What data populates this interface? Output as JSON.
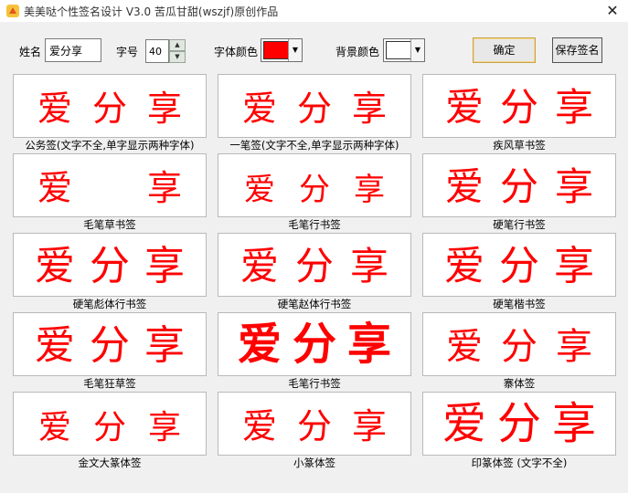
{
  "window": {
    "title": "美美哒个性签名设计 V3.0    苦瓜甘甜(wszjf)原创作品",
    "close_glyph": "✕"
  },
  "toolbar": {
    "name_label": "姓名",
    "name_value": "爱分享",
    "size_label": "字号",
    "size_value": "40",
    "font_color_label": "字体颜色",
    "font_color": "#ff0000",
    "bg_color_label": "背景颜色",
    "bg_color": "#ffffff",
    "ok_label": "确定",
    "save_label": "保存签名"
  },
  "accent_color": "#ff0000",
  "styles": [
    {
      "caption": "公务签(文字不全,单字显示两种字体)",
      "glyphs": [
        "爱",
        "分",
        "享"
      ]
    },
    {
      "caption": "一笔签(文字不全,单字显示两种字体)",
      "glyphs": [
        "爱",
        "分",
        "享"
      ]
    },
    {
      "caption": "疾风草书签",
      "glyphs": [
        "爱",
        "分",
        "享"
      ]
    },
    {
      "caption": "毛笔草书签",
      "glyphs": [
        "爱",
        "",
        "享"
      ]
    },
    {
      "caption": "毛笔行书签",
      "glyphs": [
        "爱",
        "分",
        "享"
      ]
    },
    {
      "caption": "硬笔行书签",
      "glyphs": [
        "爱",
        "分",
        "享"
      ]
    },
    {
      "caption": "硬笔彪体行书签",
      "glyphs": [
        "爱",
        "分",
        "享"
      ]
    },
    {
      "caption": "硬笔赵体行书签",
      "glyphs": [
        "爱",
        "分",
        "享"
      ]
    },
    {
      "caption": "硬笔楷书签",
      "glyphs": [
        "爱",
        "分",
        "享"
      ]
    },
    {
      "caption": "毛笔狂草签",
      "glyphs": [
        "爱",
        "分",
        "享"
      ]
    },
    {
      "caption": "毛笔行书签",
      "glyphs": [
        "爱",
        "分",
        "享"
      ]
    },
    {
      "caption": "寨体签",
      "glyphs": [
        "爱",
        "分",
        "享"
      ]
    },
    {
      "caption": "金文大篆体签",
      "glyphs": [
        "爱",
        "分",
        "享"
      ]
    },
    {
      "caption": "小篆体签",
      "glyphs": [
        "爱",
        "分",
        "享"
      ]
    },
    {
      "caption": "印篆体签 (文字不全)",
      "glyphs": [
        "爱",
        "分",
        "享"
      ]
    }
  ]
}
